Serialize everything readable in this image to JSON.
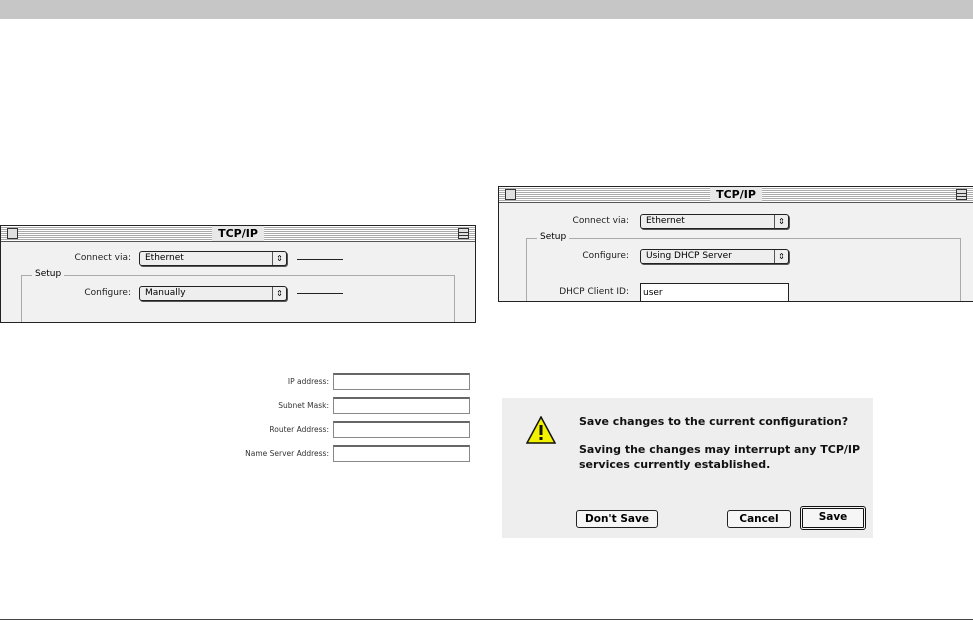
{
  "left_window": {
    "title": "TCP/IP",
    "connect_via_label": "Connect via:",
    "connect_via_value": "Ethernet",
    "setup_label": "Setup",
    "configure_label": "Configure:",
    "configure_value": "Manually"
  },
  "fields": [
    {
      "label": "IP address:"
    },
    {
      "label": "Subnet Mask:"
    },
    {
      "label": "Router Address:"
    },
    {
      "label": "Name Server Address:"
    }
  ],
  "right_window": {
    "title": "TCP/IP",
    "connect_via_label": "Connect via:",
    "connect_via_value": "Ethernet",
    "setup_label": "Setup",
    "configure_label": "Configure:",
    "configure_value": "Using DHCP Server",
    "dhcp_label": "DHCP Client ID:",
    "dhcp_value": "user"
  },
  "dialog": {
    "question": "Save changes to the current configuration?",
    "message_line1": "Saving the changes may interrupt any TCP/IP",
    "message_line2": "services currently established.",
    "dont_save": "Don't Save",
    "cancel": "Cancel",
    "save": "Save"
  }
}
